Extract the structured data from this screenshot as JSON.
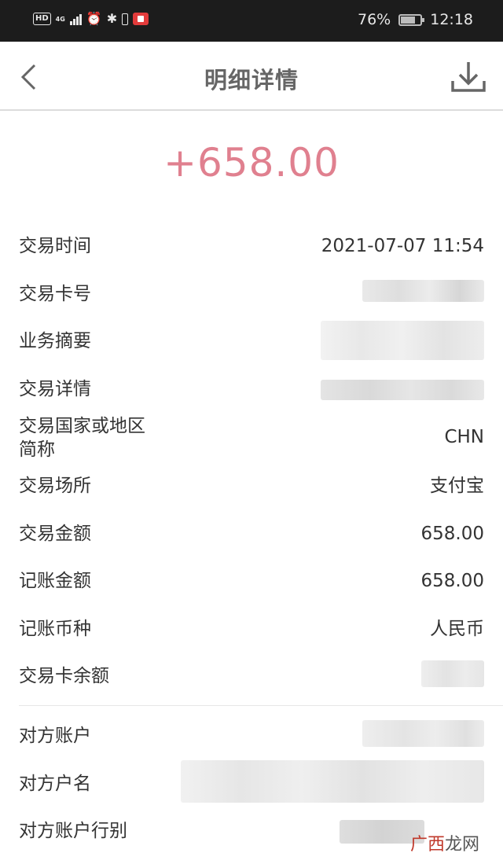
{
  "status_bar": {
    "hd": "HD",
    "network": "4G",
    "battery_pct": "76%",
    "battery_level": 0.76,
    "time": "12:18",
    "icons": [
      "signal-icon",
      "alarm-icon",
      "bluetooth-icon",
      "phone-battery-icon",
      "screen-record-icon"
    ]
  },
  "header": {
    "back_icon": "chevron-left-icon",
    "title": "明细详情",
    "download_icon": "download-icon"
  },
  "amount": "+658.00",
  "colors": {
    "amount": "#e0808f",
    "status_bar_bg": "#1c1c1c",
    "title": "#666666"
  },
  "details": [
    {
      "label": "交易时间",
      "value": "2021-07-07 11:54"
    },
    {
      "label": "交易卡号",
      "value": ""
    },
    {
      "label": "业务摘要",
      "value": ""
    },
    {
      "label": "交易详情",
      "value": ""
    },
    {
      "label": "交易国家或地区",
      "label_line2": "简称",
      "value": "CHN"
    },
    {
      "label": "交易场所",
      "value": "支付宝"
    },
    {
      "label": "交易金额",
      "value": "658.00"
    },
    {
      "label": "记账金额",
      "value": "658.00"
    },
    {
      "label": "记账币种",
      "value": "人民币"
    },
    {
      "label": "交易卡余额",
      "value": ""
    }
  ],
  "counterparty": [
    {
      "label": "对方账户",
      "value": ""
    },
    {
      "label": "对方户名",
      "value": ""
    },
    {
      "label": "对方账户行别",
      "value": ""
    }
  ],
  "watermark": {
    "part1": "广西",
    "part2": "龙网"
  }
}
